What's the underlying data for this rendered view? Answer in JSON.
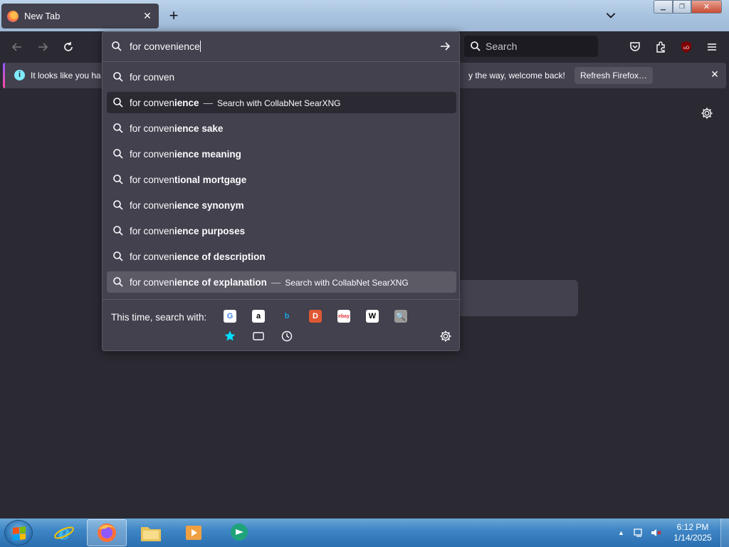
{
  "tab": {
    "title": "New Tab",
    "close": "✕"
  },
  "newtab_label": "+",
  "window_controls": {
    "minimize": "—",
    "maximize": "▢",
    "close": "✕"
  },
  "toolbar": {
    "search_placeholder": "Search"
  },
  "notification": {
    "text_left": "It looks like you ha",
    "text_right": "y the way, welcome back!",
    "button": "Refresh Firefox…",
    "close": "✕",
    "info": "i"
  },
  "urlbar": {
    "value": "for convenience",
    "suggestions": [
      {
        "typed": "for conven",
        "completion": "",
        "action": ""
      },
      {
        "typed": "for conven",
        "completion": "ience",
        "action": "Search with CollabNet SearXNG"
      },
      {
        "typed": "for conven",
        "completion": "ience sake",
        "action": ""
      },
      {
        "typed": "for conven",
        "completion": "ience meaning",
        "action": ""
      },
      {
        "typed": "for conven",
        "completion": "tional mortgage",
        "action": ""
      },
      {
        "typed": "for conven",
        "completion": "ience synonym",
        "action": ""
      },
      {
        "typed": "for conven",
        "completion": "ience purposes",
        "action": ""
      },
      {
        "typed": "for conven",
        "completion": "ience of description",
        "action": ""
      },
      {
        "typed": "for conven",
        "completion": "ience of explanation",
        "action": "Search with CollabNet SearXNG"
      }
    ],
    "separator": "—",
    "one_off_label": "This time, search with:",
    "engines": [
      {
        "name": "Google",
        "glyph": "G",
        "color": "#4285f4",
        "bg": "#ffffff"
      },
      {
        "name": "Amazon",
        "glyph": "a",
        "color": "#000000",
        "bg": "#ffffff"
      },
      {
        "name": "Bing",
        "glyph": "b",
        "color": "#1ba1e2",
        "bg": "transparent"
      },
      {
        "name": "DuckDuckGo",
        "glyph": "D",
        "color": "#ffffff",
        "bg": "#de5833"
      },
      {
        "name": "eBay",
        "glyph": "ebay",
        "color": "#e53238",
        "bg": "#ffffff"
      },
      {
        "name": "Wikipedia",
        "glyph": "W",
        "color": "#000000",
        "bg": "#ffffff"
      },
      {
        "name": "SearXNG",
        "glyph": "🔍",
        "color": "#555555",
        "bg": "#9a9a9a"
      }
    ]
  },
  "clock": {
    "time": "6:12 PM",
    "date": "1/14/2025"
  },
  "colors": {
    "accent": "#80ebff",
    "panel": "#42414d",
    "bg": "#2b2a33"
  }
}
